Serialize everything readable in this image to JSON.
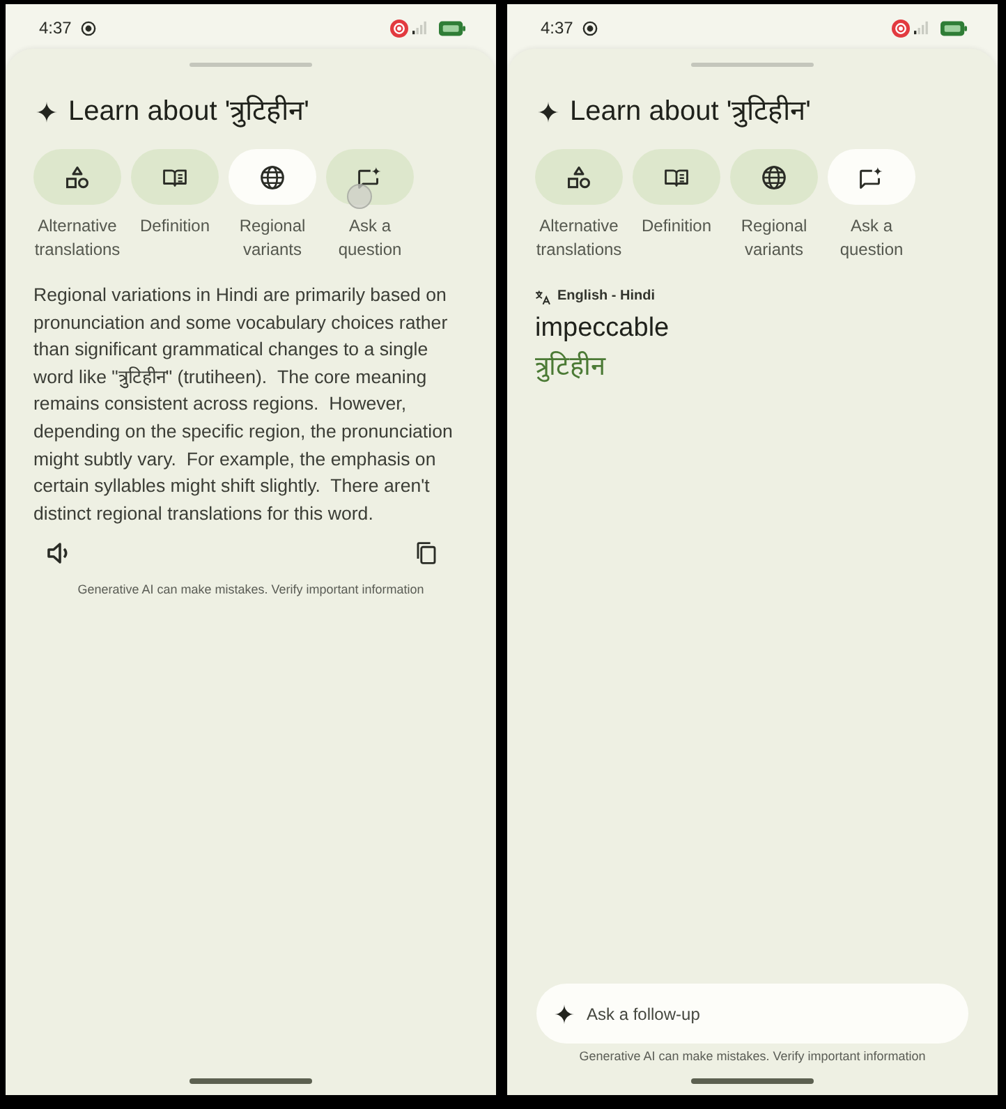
{
  "phones": [
    {
      "status_bar": {
        "time": "4:37"
      },
      "title": "Learn about 'त्रुटिहीन'",
      "chips": [
        {
          "label": "Alternative translations",
          "selected": false,
          "touched": false
        },
        {
          "label": "Definition",
          "selected": false,
          "touched": false
        },
        {
          "label": "Regional variants",
          "selected": true,
          "touched": false
        },
        {
          "label": "Ask a question",
          "selected": false,
          "touched": true
        }
      ],
      "content": {
        "kind": "answer",
        "text": "Regional variations in Hindi are primarily based on pronunciation and some vocabulary choices rather than significant grammatical changes to a single word like \"त्रुटिहीन\" (trutiheen).  The core meaning remains consistent across regions.  However, depending on the specific region, the pronunciation might subtly vary.  For example, the emphasis on certain syllables might shift slightly.  There aren't distinct regional translations for this word.",
        "disclaimer": "Generative AI can make mistakes. Verify important information"
      }
    },
    {
      "status_bar": {
        "time": "4:37"
      },
      "title": "Learn about 'त्रुटिहीन'",
      "chips": [
        {
          "label": "Alternative translations",
          "selected": false,
          "touched": false
        },
        {
          "label": "Definition",
          "selected": false,
          "touched": false
        },
        {
          "label": "Regional variants",
          "selected": false,
          "touched": false
        },
        {
          "label": "Ask a question",
          "selected": true,
          "touched": false
        }
      ],
      "content": {
        "kind": "translation",
        "language_pair": "English - Hindi",
        "source": "impeccable",
        "target": "त्रुटिहीन"
      },
      "footer": {
        "placeholder": "Ask a follow-up",
        "disclaimer": "Generative AI can make mistakes. Verify important information"
      }
    }
  ]
}
